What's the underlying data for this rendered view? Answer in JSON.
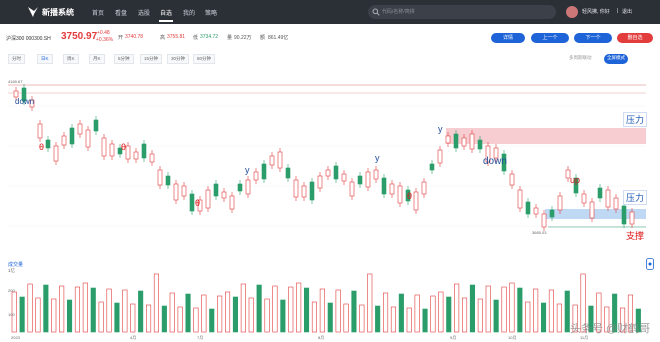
{
  "nav": {
    "brand": "新播系统",
    "items": [
      "首页",
      "看盘",
      "选股",
      "自选",
      "我的",
      "策略"
    ],
    "active_index": 3,
    "search_placeholder": "代码/名称/简拼",
    "user": "轻风拂, 你好",
    "logout": "退出"
  },
  "quote": {
    "name": "沪深300 000300.SH",
    "price": "3750.97",
    "change": "+0.48",
    "change_pct": "+0.36%",
    "open": "3740.78",
    "high": "3755.81",
    "low": "3734.72",
    "volume": "90.22万",
    "amount": "861.49亿"
  },
  "actions": {
    "detail": "详情",
    "prev": "上一个",
    "next": "下一个",
    "remove": "删自选"
  },
  "periods": {
    "items": [
      "分时",
      "日K",
      "周K",
      "月K",
      "5分钟",
      "15分钟",
      "30分钟",
      "60分钟"
    ],
    "active_index": 1,
    "left_option": "多周期联动",
    "right_option": "全屏模式"
  },
  "chart_data": {
    "type": "candlestick",
    "title": "",
    "annotations": {
      "high_label": "4169.67",
      "low_label": "3665.03",
      "words": [
        "down",
        "θ",
        "θ",
        "θ",
        "θ",
        "y",
        "y",
        "y",
        "down",
        "up"
      ],
      "right_labels": [
        "压力",
        "压力",
        "支撑"
      ]
    },
    "volume_header": "成交量",
    "volume_value": "1亿",
    "volume_ticks": [
      "200",
      "100"
    ],
    "date_labels": [
      "2023",
      "4月",
      "7月",
      "8月",
      "9月",
      "10月",
      "11月"
    ]
  },
  "colors": {
    "up": "#e23c3c",
    "down": "#2a9d6a",
    "pressure_band": "#f7c8cc",
    "support_band": "#b8d4f3",
    "topbar": "#2b2f36",
    "accent": "#1e64d8"
  },
  "watermark": "头条号 @财鹤哥"
}
